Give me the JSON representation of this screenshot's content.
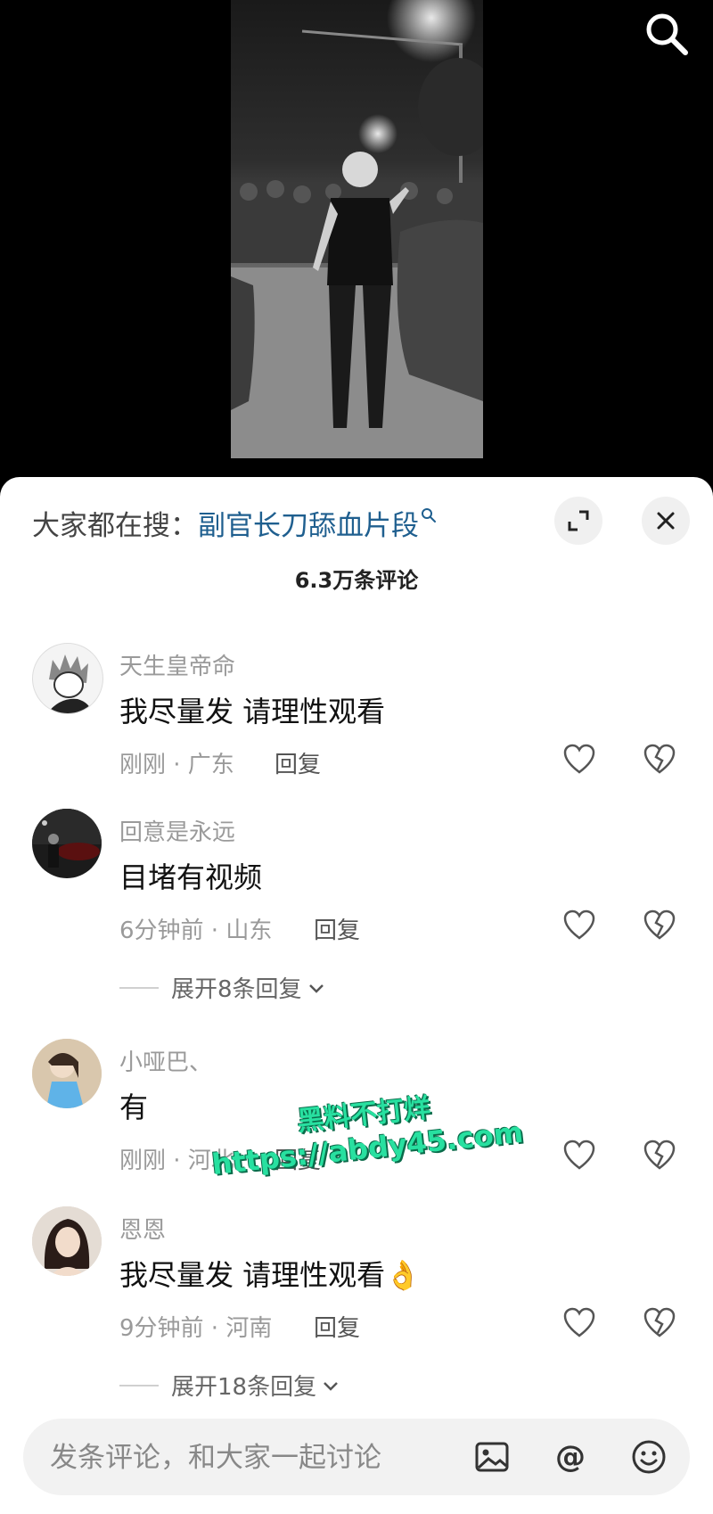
{
  "sheet": {
    "search_prefix": "大家都在搜：",
    "search_term": "副官长刀舔血片段",
    "comment_count": "6.3万条评论"
  },
  "comments": [
    {
      "username": "天生皇帝命",
      "text": "我尽量发 请理性观看",
      "meta": "刚刚 · 广东",
      "reply": "回复"
    },
    {
      "username": "回意是永远",
      "text": "目堵有视频",
      "meta": "6分钟前 · 山东",
      "reply": "回复",
      "expand": "展开8条回复"
    },
    {
      "username": "小哑巴、",
      "text": "有",
      "meta": "刚刚 · 河北",
      "reply": "回复"
    },
    {
      "username": "恩恩",
      "text": "我尽量发  请理性观看👌",
      "meta": "9分钟前 · 河南",
      "reply": "回复",
      "expand": "展开18条回复"
    }
  ],
  "watermark": {
    "line1": "黑料不打烊",
    "line2": "https://abdy45.com"
  },
  "input": {
    "placeholder": "发条评论，和大家一起讨论"
  },
  "icons": [
    "search-icon",
    "expand-icon",
    "close-icon",
    "heart-icon",
    "broken-heart-icon",
    "image-icon",
    "at-icon",
    "emoji-icon"
  ]
}
